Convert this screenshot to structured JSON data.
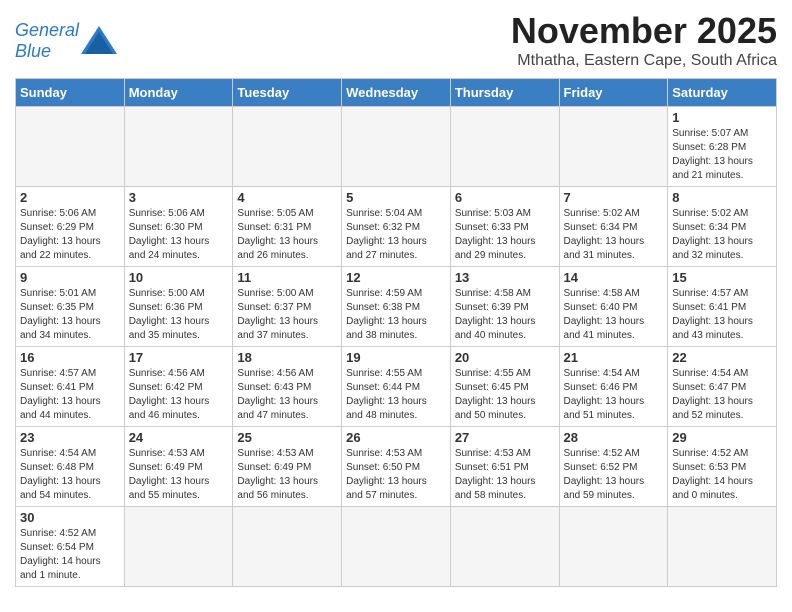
{
  "header": {
    "logo_text_general": "General",
    "logo_text_blue": "Blue",
    "month_title": "November 2025",
    "location": "Mthatha, Eastern Cape, South Africa"
  },
  "weekdays": [
    "Sunday",
    "Monday",
    "Tuesday",
    "Wednesday",
    "Thursday",
    "Friday",
    "Saturday"
  ],
  "weeks": [
    [
      {
        "day": "",
        "info": ""
      },
      {
        "day": "",
        "info": ""
      },
      {
        "day": "",
        "info": ""
      },
      {
        "day": "",
        "info": ""
      },
      {
        "day": "",
        "info": ""
      },
      {
        "day": "",
        "info": ""
      },
      {
        "day": "1",
        "info": "Sunrise: 5:07 AM\nSunset: 6:28 PM\nDaylight: 13 hours and 21 minutes."
      }
    ],
    [
      {
        "day": "2",
        "info": "Sunrise: 5:06 AM\nSunset: 6:29 PM\nDaylight: 13 hours and 22 minutes."
      },
      {
        "day": "3",
        "info": "Sunrise: 5:06 AM\nSunset: 6:30 PM\nDaylight: 13 hours and 24 minutes."
      },
      {
        "day": "4",
        "info": "Sunrise: 5:05 AM\nSunset: 6:31 PM\nDaylight: 13 hours and 26 minutes."
      },
      {
        "day": "5",
        "info": "Sunrise: 5:04 AM\nSunset: 6:32 PM\nDaylight: 13 hours and 27 minutes."
      },
      {
        "day": "6",
        "info": "Sunrise: 5:03 AM\nSunset: 6:33 PM\nDaylight: 13 hours and 29 minutes."
      },
      {
        "day": "7",
        "info": "Sunrise: 5:02 AM\nSunset: 6:34 PM\nDaylight: 13 hours and 31 minutes."
      },
      {
        "day": "8",
        "info": "Sunrise: 5:02 AM\nSunset: 6:34 PM\nDaylight: 13 hours and 32 minutes."
      }
    ],
    [
      {
        "day": "9",
        "info": "Sunrise: 5:01 AM\nSunset: 6:35 PM\nDaylight: 13 hours and 34 minutes."
      },
      {
        "day": "10",
        "info": "Sunrise: 5:00 AM\nSunset: 6:36 PM\nDaylight: 13 hours and 35 minutes."
      },
      {
        "day": "11",
        "info": "Sunrise: 5:00 AM\nSunset: 6:37 PM\nDaylight: 13 hours and 37 minutes."
      },
      {
        "day": "12",
        "info": "Sunrise: 4:59 AM\nSunset: 6:38 PM\nDaylight: 13 hours and 38 minutes."
      },
      {
        "day": "13",
        "info": "Sunrise: 4:58 AM\nSunset: 6:39 PM\nDaylight: 13 hours and 40 minutes."
      },
      {
        "day": "14",
        "info": "Sunrise: 4:58 AM\nSunset: 6:40 PM\nDaylight: 13 hours and 41 minutes."
      },
      {
        "day": "15",
        "info": "Sunrise: 4:57 AM\nSunset: 6:41 PM\nDaylight: 13 hours and 43 minutes."
      }
    ],
    [
      {
        "day": "16",
        "info": "Sunrise: 4:57 AM\nSunset: 6:41 PM\nDaylight: 13 hours and 44 minutes."
      },
      {
        "day": "17",
        "info": "Sunrise: 4:56 AM\nSunset: 6:42 PM\nDaylight: 13 hours and 46 minutes."
      },
      {
        "day": "18",
        "info": "Sunrise: 4:56 AM\nSunset: 6:43 PM\nDaylight: 13 hours and 47 minutes."
      },
      {
        "day": "19",
        "info": "Sunrise: 4:55 AM\nSunset: 6:44 PM\nDaylight: 13 hours and 48 minutes."
      },
      {
        "day": "20",
        "info": "Sunrise: 4:55 AM\nSunset: 6:45 PM\nDaylight: 13 hours and 50 minutes."
      },
      {
        "day": "21",
        "info": "Sunrise: 4:54 AM\nSunset: 6:46 PM\nDaylight: 13 hours and 51 minutes."
      },
      {
        "day": "22",
        "info": "Sunrise: 4:54 AM\nSunset: 6:47 PM\nDaylight: 13 hours and 52 minutes."
      }
    ],
    [
      {
        "day": "23",
        "info": "Sunrise: 4:54 AM\nSunset: 6:48 PM\nDaylight: 13 hours and 54 minutes."
      },
      {
        "day": "24",
        "info": "Sunrise: 4:53 AM\nSunset: 6:49 PM\nDaylight: 13 hours and 55 minutes."
      },
      {
        "day": "25",
        "info": "Sunrise: 4:53 AM\nSunset: 6:49 PM\nDaylight: 13 hours and 56 minutes."
      },
      {
        "day": "26",
        "info": "Sunrise: 4:53 AM\nSunset: 6:50 PM\nDaylight: 13 hours and 57 minutes."
      },
      {
        "day": "27",
        "info": "Sunrise: 4:53 AM\nSunset: 6:51 PM\nDaylight: 13 hours and 58 minutes."
      },
      {
        "day": "28",
        "info": "Sunrise: 4:52 AM\nSunset: 6:52 PM\nDaylight: 13 hours and 59 minutes."
      },
      {
        "day": "29",
        "info": "Sunrise: 4:52 AM\nSunset: 6:53 PM\nDaylight: 14 hours and 0 minutes."
      }
    ],
    [
      {
        "day": "30",
        "info": "Sunrise: 4:52 AM\nSunset: 6:54 PM\nDaylight: 14 hours and 1 minute."
      },
      {
        "day": "",
        "info": ""
      },
      {
        "day": "",
        "info": ""
      },
      {
        "day": "",
        "info": ""
      },
      {
        "day": "",
        "info": ""
      },
      {
        "day": "",
        "info": ""
      },
      {
        "day": "",
        "info": ""
      }
    ]
  ]
}
